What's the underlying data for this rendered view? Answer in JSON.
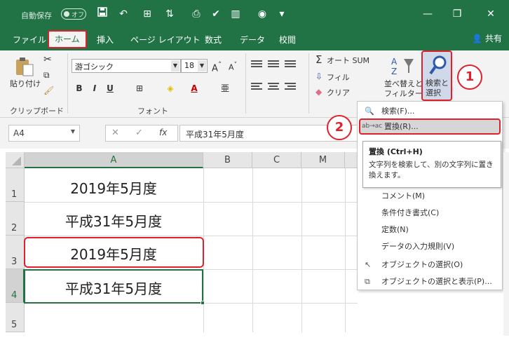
{
  "titlebar": {
    "autosave_label": "自動保存",
    "autosave_state": "オフ"
  },
  "tabs": [
    "ファイル",
    "ホーム",
    "挿入",
    "ページ レイアウト",
    "数式",
    "データ",
    "校閲"
  ],
  "share_label": "共有",
  "ribbon": {
    "paste_label": "貼り付け",
    "clipboard_group": "クリップボード",
    "font_group": "フォント",
    "font_name": "游ゴシック",
    "font_size": "18",
    "autosum_label": "オート SUM",
    "fill_label": "フィル",
    "clear_label": "クリア",
    "sort_label_1": "並べ替えと",
    "sort_label_2": "フィルター",
    "find_label_1": "検索と",
    "find_label_2": "選択"
  },
  "formula_bar": {
    "name_box": "A4",
    "formula": "平成31年5月度"
  },
  "columns": [
    "A",
    "B",
    "C",
    "M"
  ],
  "rows": [
    "1",
    "2",
    "3",
    "4",
    "5"
  ],
  "cells": {
    "a1": "2019年5月度",
    "a2": "平成31年5月度",
    "a3": "2019年5月度",
    "a4": "平成31年5月度"
  },
  "menu": {
    "search": "検索(F)...",
    "replace": "置換(R)...",
    "comment": "コメント(M)",
    "conditional": "条件付き書式(C)",
    "constants": "定数(N)",
    "validation": "データの入力規則(V)",
    "select_objects": "オブジェクトの選択(O)",
    "selection_pane": "オブジェクトの選択と表示(P)..."
  },
  "tooltip": {
    "title": "置換 (Ctrl+H)",
    "desc": "文字列を検索して、別の文字列に置き換えます。"
  },
  "callouts": [
    "1",
    "2"
  ],
  "colors": {
    "excel_green": "#217346",
    "callout_red": "#e0202a"
  }
}
